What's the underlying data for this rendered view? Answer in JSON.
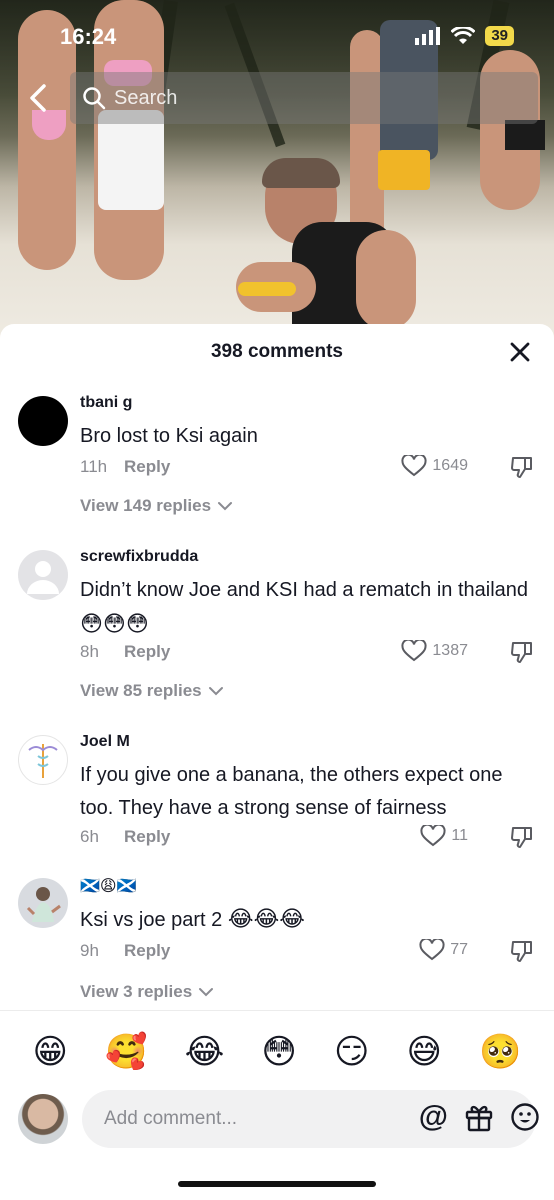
{
  "status_bar": {
    "time": "16:24",
    "battery": "39"
  },
  "search": {
    "placeholder": "Search"
  },
  "sheet": {
    "comments_count": "398 comments"
  },
  "comments": [
    {
      "user": "tbani g",
      "text": "Bro lost to Ksi again",
      "time": "11h",
      "reply_label": "Reply",
      "likes": "1649",
      "view_replies": "View 149 replies",
      "avatar": "black-circle-avatar"
    },
    {
      "user": "screwfixbrudda",
      "text": "Didn’t know Joe and KSI had a rematch in thailand",
      "text_emoji": "😳😳😳",
      "time": "8h",
      "reply_label": "Reply",
      "likes": "1387",
      "view_replies": "View 85 replies",
      "avatar": "default-grey-avatar"
    },
    {
      "user": "Joel M",
      "text": "If you give one a banana, the others expect one too. They have a strong sense of fairness",
      "time": "6h",
      "reply_label": "Reply",
      "likes": "11",
      "avatar": "caduceus-logo-avatar"
    },
    {
      "user": "🏴󠁧󠁢󠁳󠁣󠁴󠁿😩🏴󠁧󠁢󠁳󠁣󠁴󠁿",
      "text": "Ksi vs joe part 2",
      "text_emoji": "😂😂😂",
      "time": "9h",
      "reply_label": "Reply",
      "likes": "77",
      "view_replies": "View 3 replies",
      "avatar": "illustrated-person-avatar"
    }
  ],
  "emoji_bar": [
    "😁",
    "🥰",
    "😂",
    "😳",
    "😏",
    "😅",
    "🥺"
  ],
  "composer": {
    "placeholder": "Add comment..."
  },
  "colors": {
    "secondary_text": "#8a8b91",
    "primary_text": "#161823",
    "input_bg": "#f1f1f2",
    "battery": "#f2d94a"
  }
}
